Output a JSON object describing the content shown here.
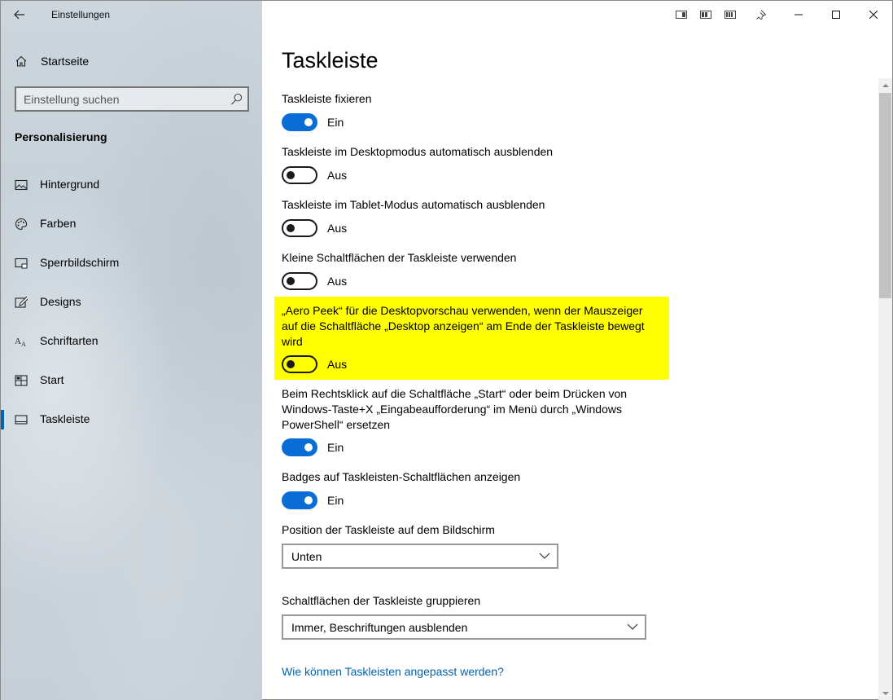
{
  "window": {
    "app_title": "Einstellungen"
  },
  "sidebar": {
    "home_label": "Startseite",
    "search_placeholder": "Einstellung suchen",
    "section_title": "Personalisierung",
    "items": [
      {
        "label": "Hintergrund",
        "icon": "picture-icon"
      },
      {
        "label": "Farben",
        "icon": "palette-icon"
      },
      {
        "label": "Sperrbildschirm",
        "icon": "lock-screen-icon"
      },
      {
        "label": "Designs",
        "icon": "brush-icon"
      },
      {
        "label": "Schriftarten",
        "icon": "font-icon"
      },
      {
        "label": "Start",
        "icon": "start-icon"
      },
      {
        "label": "Taskleiste",
        "icon": "taskbar-icon",
        "active": true
      }
    ]
  },
  "page": {
    "title": "Taskleiste",
    "settings": [
      {
        "label": "Taskleiste fixieren",
        "state": "Ein",
        "on": true
      },
      {
        "label": "Taskleiste im Desktopmodus automatisch ausblenden",
        "state": "Aus",
        "on": false
      },
      {
        "label": "Taskleiste im Tablet-Modus automatisch ausblenden",
        "state": "Aus",
        "on": false
      },
      {
        "label": "Kleine Schaltflächen der Taskleiste verwenden",
        "state": "Aus",
        "on": false
      },
      {
        "label": "„Aero Peek“ für die Desktopvorschau verwenden, wenn der Mauszeiger auf die Schaltfläche „Desktop anzeigen“ am Ende der Taskleiste bewegt wird",
        "state": "Aus",
        "on": false,
        "highlighted": true
      },
      {
        "label": "Beim Rechtsklick auf die Schaltfläche „Start“ oder beim Drücken von Windows-Taste+X „Eingabeaufforderung“ im Menü durch „Windows PowerShell“ ersetzen",
        "state": "Ein",
        "on": true
      },
      {
        "label": "Badges auf Taskleisten-Schaltflächen anzeigen",
        "state": "Ein",
        "on": true
      }
    ],
    "position_label": "Position der Taskleiste auf dem Bildschirm",
    "position_value": "Unten",
    "group_label": "Schaltflächen der Taskleiste gruppieren",
    "group_value": "Immer, Beschriftungen ausblenden",
    "help_link": "Wie können Taskleisten angepasst werden?"
  },
  "colors": {
    "accent": "#0a6cd5",
    "highlight": "#ffff00",
    "link": "#0063b1"
  }
}
